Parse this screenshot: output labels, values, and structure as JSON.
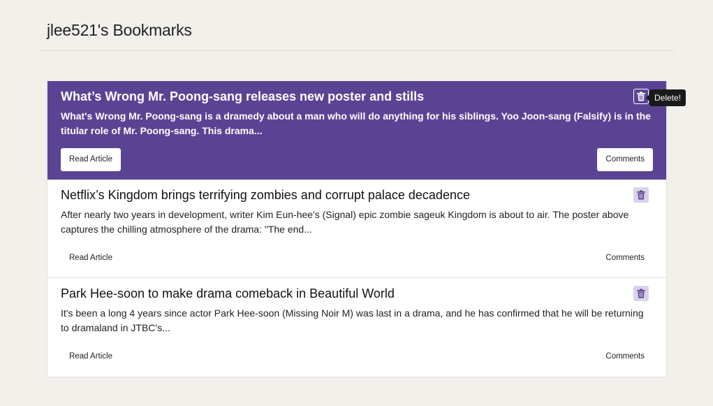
{
  "header": {
    "title": "jlee521's Bookmarks"
  },
  "tooltip": {
    "text": "Delete!"
  },
  "colors": {
    "accent": "#5b4394",
    "trash_bg": "#d9d3e8",
    "trash_icon": "#5b4394"
  },
  "bookmarks": [
    {
      "title": "What’s Wrong Mr. Poong-sang releases new poster and stills",
      "description": "What's Wrong Mr. Poong-sang is a dramedy about a man who will do anything for his siblings. Yoo Joon-sang (Falsify) is in the titular role of Mr. Poong-sang. This drama...",
      "read_label": "Read Article",
      "comments_label": "Comments",
      "delete_icon": "trash-icon"
    },
    {
      "title": "Netflix’s Kingdom brings terrifying zombies and corrupt palace decadence",
      "description": "After nearly two years in development, writer Kim Eun-hee's (Signal) epic zombie sageuk Kingdom is about to air. The poster above captures the chilling atmosphere of the drama: \"The end...",
      "read_label": "Read Article",
      "comments_label": "Comments",
      "delete_icon": "trash-icon"
    },
    {
      "title": "Park Hee-soon to make drama comeback in Beautiful World",
      "description": "It's been a long 4 years since actor Park Hee-soon (Missing Noir M) was last in a drama, and he has confirmed that he will be returning to dramaland in JTBC's...",
      "read_label": "Read Article",
      "comments_label": "Comments",
      "delete_icon": "trash-icon"
    }
  ]
}
